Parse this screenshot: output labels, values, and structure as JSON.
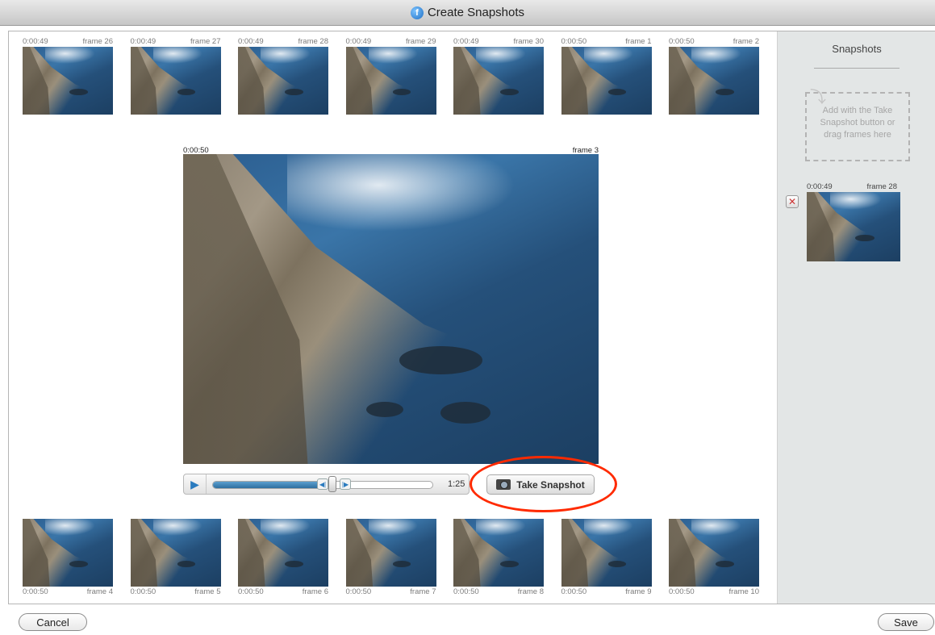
{
  "window": {
    "title": "Create Snapshots",
    "app_icon": "f-logo-icon"
  },
  "top_strip": [
    {
      "time": "0:00:49",
      "frame": "frame 26"
    },
    {
      "time": "0:00:49",
      "frame": "frame 27"
    },
    {
      "time": "0:00:49",
      "frame": "frame 28"
    },
    {
      "time": "0:00:49",
      "frame": "frame 29"
    },
    {
      "time": "0:00:49",
      "frame": "frame 30"
    },
    {
      "time": "0:00:50",
      "frame": "frame 1"
    },
    {
      "time": "0:00:50",
      "frame": "frame 2"
    }
  ],
  "current": {
    "time": "0:00:50",
    "frame": "frame 3"
  },
  "player": {
    "time": "1:25",
    "progress": 0.5
  },
  "snapshot_button": "Take Snapshot",
  "bottom_strip": [
    {
      "time": "0:00:50",
      "frame": "frame 4"
    },
    {
      "time": "0:00:50",
      "frame": "frame 5"
    },
    {
      "time": "0:00:50",
      "frame": "frame 6"
    },
    {
      "time": "0:00:50",
      "frame": "frame 7"
    },
    {
      "time": "0:00:50",
      "frame": "frame 8"
    },
    {
      "time": "0:00:50",
      "frame": "frame 9"
    },
    {
      "time": "0:00:50",
      "frame": "frame 10"
    }
  ],
  "sidebar": {
    "title": "Snapshots",
    "dropzone_text": "Add with the Take Snapshot button or drag frames here",
    "snapshots": [
      {
        "time": "0:00:49",
        "frame": "frame 28"
      }
    ]
  },
  "footer": {
    "cancel": "Cancel",
    "save": "Save"
  },
  "colors": {
    "accent": "#2a7bbf",
    "callout": "#ff2a00",
    "sidebar_bg": "#e3e6e6"
  }
}
